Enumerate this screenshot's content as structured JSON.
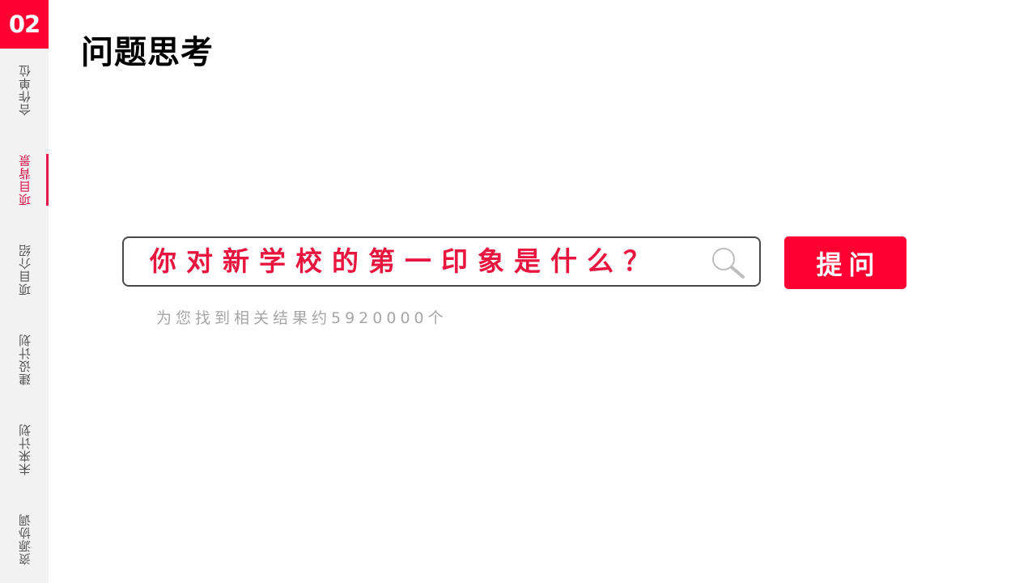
{
  "section": {
    "number": "02"
  },
  "nav": {
    "items": [
      {
        "label": "合作单位"
      },
      {
        "label": "项目背景"
      },
      {
        "label": "项目介绍"
      },
      {
        "label": "建设计划"
      },
      {
        "label": "未来计划"
      },
      {
        "label": "资源协调"
      }
    ],
    "active": "项目背景"
  },
  "header": {
    "title": "问题思考"
  },
  "search": {
    "query": "你对新学校的第一印象是什么？",
    "button_label": "提问",
    "result_text": "为您找到相关结果约5920000个"
  },
  "colors": {
    "accent": "#ff0033",
    "query_text": "#e8153f",
    "sidebar_bg": "#f2f2f2",
    "muted_text": "#a6a6a6"
  },
  "icons": {
    "search": "magnifier-icon"
  }
}
